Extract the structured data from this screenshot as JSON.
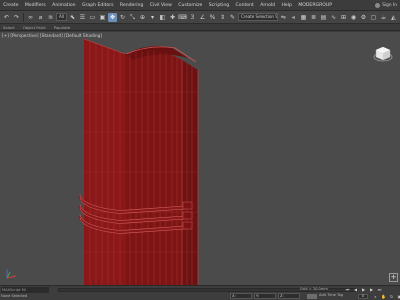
{
  "menubar": {
    "items": [
      "Create",
      "Modifiers",
      "Animation",
      "Graph Editors",
      "Rendering",
      "Civil View",
      "Customize",
      "Scripting",
      "Content",
      "Arnold",
      "Help",
      "MODERGROUP"
    ],
    "signin": "Sign In"
  },
  "toolbar": {
    "selection_filter": "All",
    "selection_set": "Create Selection Se"
  },
  "subbar": {
    "items": [
      "Select",
      "Object Paint",
      "Populate"
    ]
  },
  "viewport": {
    "label": "[+] [Perspective] [Standard] [Default Shading]",
    "model_color": "#8e1a1a",
    "wire_color": "#c44a4a",
    "background": "#4b4b4b"
  },
  "status": {
    "maxscript": "MAXScript Mi",
    "selection": "None Selected",
    "x": "X:",
    "y": "Y:",
    "z": "Z:",
    "grid": "Grid = 10.0mm",
    "setkey": "Add Time Tag",
    "frame": "0"
  },
  "icons": {
    "undo": "undo-icon",
    "redo": "redo-icon",
    "select": "select-icon",
    "move": "move-icon",
    "rotate": "rotate-icon",
    "scale": "scale-icon",
    "snap": "snap-icon",
    "render": "render-icon",
    "viewcube": "viewcube-icon",
    "maximize": "maximize-viewport-icon"
  }
}
